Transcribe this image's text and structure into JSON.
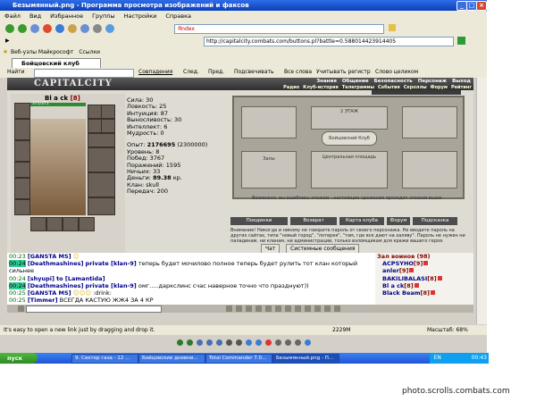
{
  "window": {
    "title": "Безымянный.png - Программа просмотра изображений и факсов",
    "controls": [
      "_",
      "□",
      "×"
    ]
  },
  "menu": [
    "Файл",
    "Вид",
    "Избранное",
    "Группы",
    "Настройки",
    "Справка"
  ],
  "toolbar": {
    "search_placeholder": "Яndex"
  },
  "address": {
    "url": "http://capitalcity.combats.com/buttons.pl?battle=0.588014423914405"
  },
  "links": {
    "web_slices": "Веб-узлы Майкрософт",
    "links": "Ссылки"
  },
  "tab": {
    "title": "Бойцовский клуб"
  },
  "findbar": {
    "label": "Найти",
    "matches": "Совпадения",
    "next": "След.",
    "prev": "Пред.",
    "highlight": "Подсвечивать",
    "all_words": "Все слова",
    "case": "Учитывать регистр",
    "whole": "Слово целиком"
  },
  "game": {
    "logo": "CAPITALCITY",
    "nav_top": [
      "Знания",
      "Общение",
      "Безопасность",
      "Персонаж",
      "Выход"
    ],
    "nav_bottom": [
      "Радио",
      "Клуб-история",
      "Телеграммы",
      "События",
      "Скроллы",
      "Форум",
      "Рейтинг"
    ],
    "character": {
      "name": "Bl a ck",
      "level": "[8]",
      "hp": "371/371"
    },
    "stats": [
      {
        "label": "Сила:",
        "value": "30"
      },
      {
        "label": "Ловкость:",
        "value": "25"
      },
      {
        "label": "Интуиция:",
        "value": "87"
      },
      {
        "label": "Выносливость:",
        "value": "30"
      },
      {
        "label": "Интеллект:",
        "value": "6"
      },
      {
        "label": "Мудрость:",
        "value": "0"
      }
    ],
    "stats2": [
      {
        "label": "Опыт:",
        "value": "2176695",
        "extra": "(2300000)"
      },
      {
        "label": "Уровень:",
        "value": "8"
      },
      {
        "label": "Побед:",
        "value": "3767"
      },
      {
        "label": "Поражений:",
        "value": "1595"
      },
      {
        "label": "Ничьих:",
        "value": "33"
      },
      {
        "label": "Деньги:",
        "value": "89.38",
        "extra": "кр."
      },
      {
        "label": "Клан:",
        "value": "skull"
      },
      {
        "label": "Передач:",
        "value": "200"
      }
    ],
    "map": {
      "rooms": [
        "Залы",
        "2 ЭТАЖ",
        "Бойцовский Клуб",
        "Центральная площадь"
      ],
      "caption": "Возможно, вы ошиблись этажом - настоящие сражения проходят этажом выше."
    },
    "buttons": [
      "Поединки",
      "Возврат",
      "Карта клуба",
      "Форум",
      "Подсказка"
    ],
    "warning": "Внимание! Никогда и никому не говорите пароль от своего персонажа. Не вводите пароль на других сайтах, типа \"новый город\", \"лотерея\", \"там, где все дают на халяву\". Пароль не нужен ни паладинам, ни кланам, ни администрации, только взломщикам для кражи вашего героя.",
    "chat_tabs": [
      "Чат",
      "Системные сообщения"
    ],
    "chat": [
      {
        "time": "00:23",
        "nick": "[GANSTA MS]",
        "text": "",
        "hl": false
      },
      {
        "time": "00:24",
        "nick": "[Deathmashines]",
        "priv": "private [klan-9]",
        "text": "теперь будет мочилово полное теперь будет рулить тот клан который сильнее",
        "hl": true
      },
      {
        "time": "00:24",
        "nick": "[shyupi]",
        "priv": "to [Lamantida]",
        "text": "",
        "hl": false
      },
      {
        "time": "00:24",
        "nick": "[Deathmashines]",
        "priv": "private [klan-9]",
        "text": "омг.....даркслинс счас наверное точно что празднуют))",
        "hl": true
      },
      {
        "time": "00:25",
        "nick": "[GANSTA MS]",
        "text": ":drink:",
        "hl": false
      },
      {
        "time": "00:25",
        "nick": "[Timmer]",
        "text": "ВСЕГДА КАСТУЮ ЖЖ4 ЗА 4 КР",
        "hl": false
      }
    ],
    "zone": {
      "title": "Зал воинов",
      "count": "(98)",
      "users": [
        {
          "name": "ACPSYHO",
          "level": "[9]"
        },
        {
          "name": "anler",
          "level": "[9]"
        },
        {
          "name": "BAKILIBALASI",
          "level": "[8]"
        },
        {
          "name": "Bl a ck",
          "level": "[8]"
        },
        {
          "name": "Black Beam",
          "level": "[8]"
        }
      ]
    }
  },
  "status": {
    "hint": "It's easy to open a new link just by dragging and drop it.",
    "size": "2229M",
    "zoom": "Масштаб: 68%"
  },
  "taskbar": {
    "start": "пуск",
    "tasks": [
      "9. Сектор газа - 12 ...",
      "Бойцовские дневни...",
      "Total Commander 7.0...",
      "Безымянный.png - П..."
    ],
    "lang": "EN",
    "clock": "00:43"
  },
  "watermark": "photo.scrolls.combats.com"
}
